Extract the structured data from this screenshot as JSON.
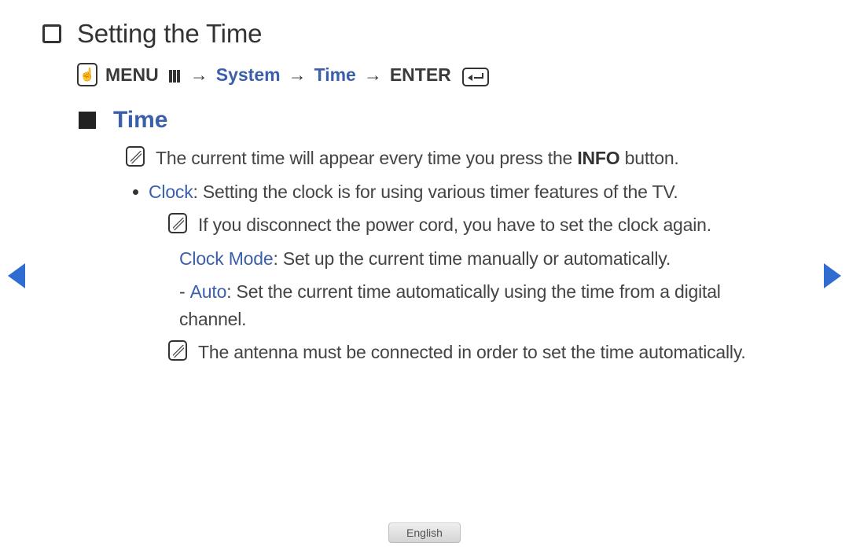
{
  "title": "Setting the Time",
  "breadcrumb": {
    "menu_label": "MENU",
    "system_label": "System",
    "time_label": "Time",
    "enter_label": "ENTER",
    "arrow": "→"
  },
  "section": {
    "title": "Time",
    "note_info_prefix": "The current time will appear every time you press the ",
    "note_info_bold": "INFO",
    "note_info_suffix": " button.",
    "clock_label": "Clock",
    "clock_text": ": Setting the clock is for using various timer features of the TV.",
    "clock_disconnect_note": "If you disconnect the power cord, you have to set the clock again.",
    "clock_mode_label": "Clock Mode",
    "clock_mode_text": ": Set up the current time manually or automatically.",
    "auto_dash": "- ",
    "auto_label": "Auto",
    "auto_text": ": Set the current time automatically using the time from a digital channel.",
    "antenna_note": "The antenna must be connected in order to set the time automatically."
  },
  "footer": {
    "language": "English"
  }
}
